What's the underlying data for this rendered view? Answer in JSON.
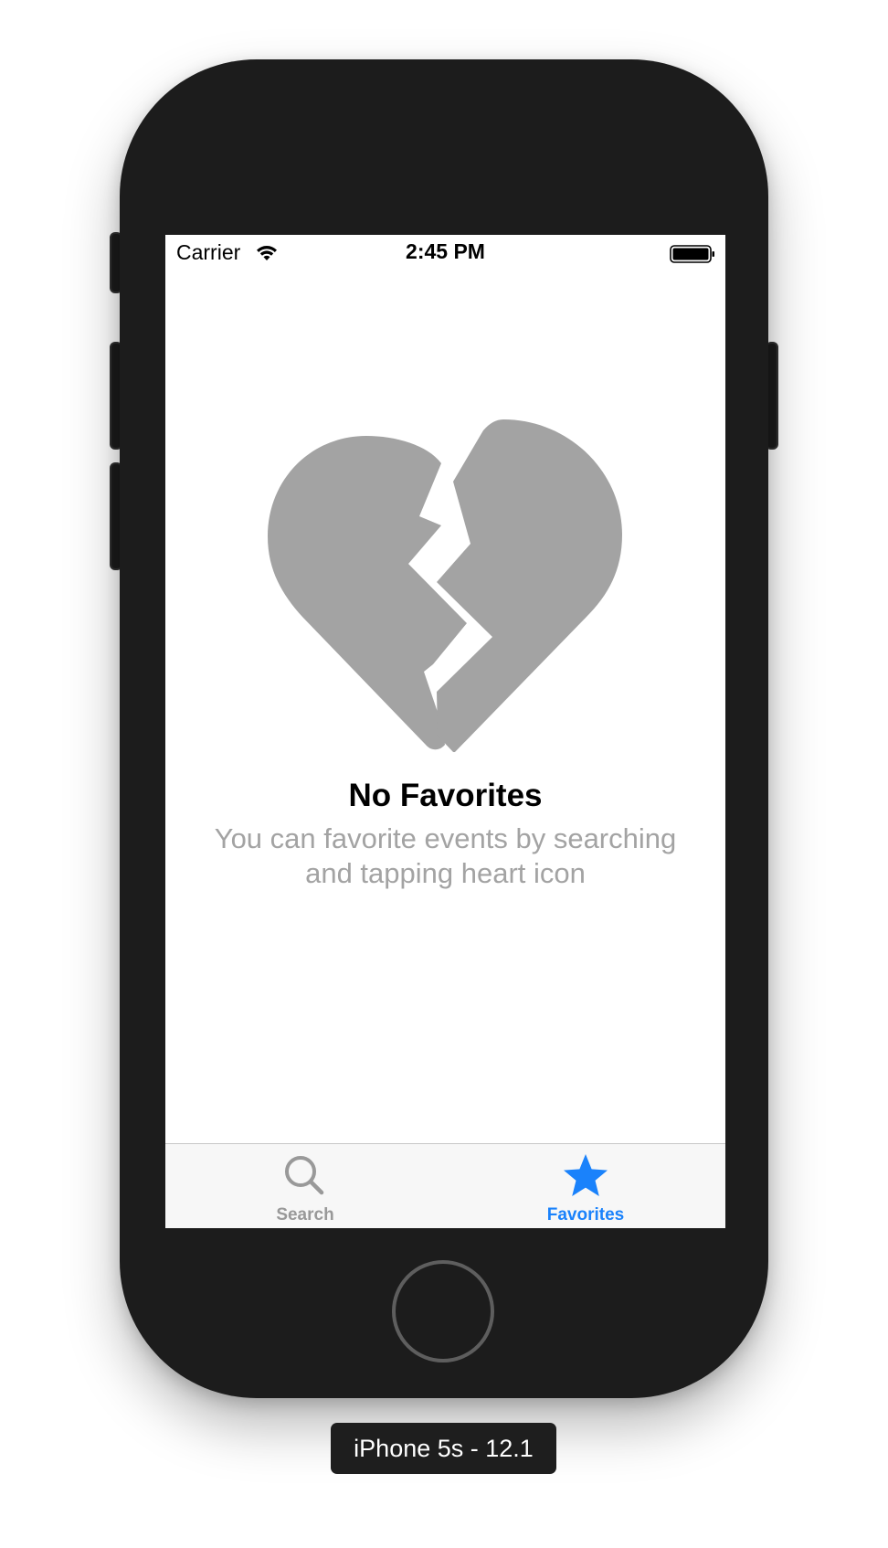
{
  "status_bar": {
    "carrier": "Carrier",
    "time": "2:45 PM",
    "icons": [
      "wifi-icon",
      "battery-icon"
    ]
  },
  "empty_state": {
    "icon": "broken-heart-icon",
    "icon_color": "#a3a3a3",
    "title": "No Favorites",
    "message": "You can favorite events by searching and tapping heart icon"
  },
  "tab_bar": {
    "tabs": [
      {
        "label": "Search",
        "icon": "search-icon",
        "selected": false
      },
      {
        "label": "Favorites",
        "icon": "star-icon",
        "selected": true
      }
    ],
    "active_color": "#1a82fb",
    "inactive_color": "#999999"
  },
  "simulator": {
    "device_label": "iPhone 5s - 12.1"
  },
  "colors": {
    "phone_body": "#1c1c1c",
    "screen_bg": "#ffffff",
    "tab_bar_bg": "#f7f7f7"
  }
}
